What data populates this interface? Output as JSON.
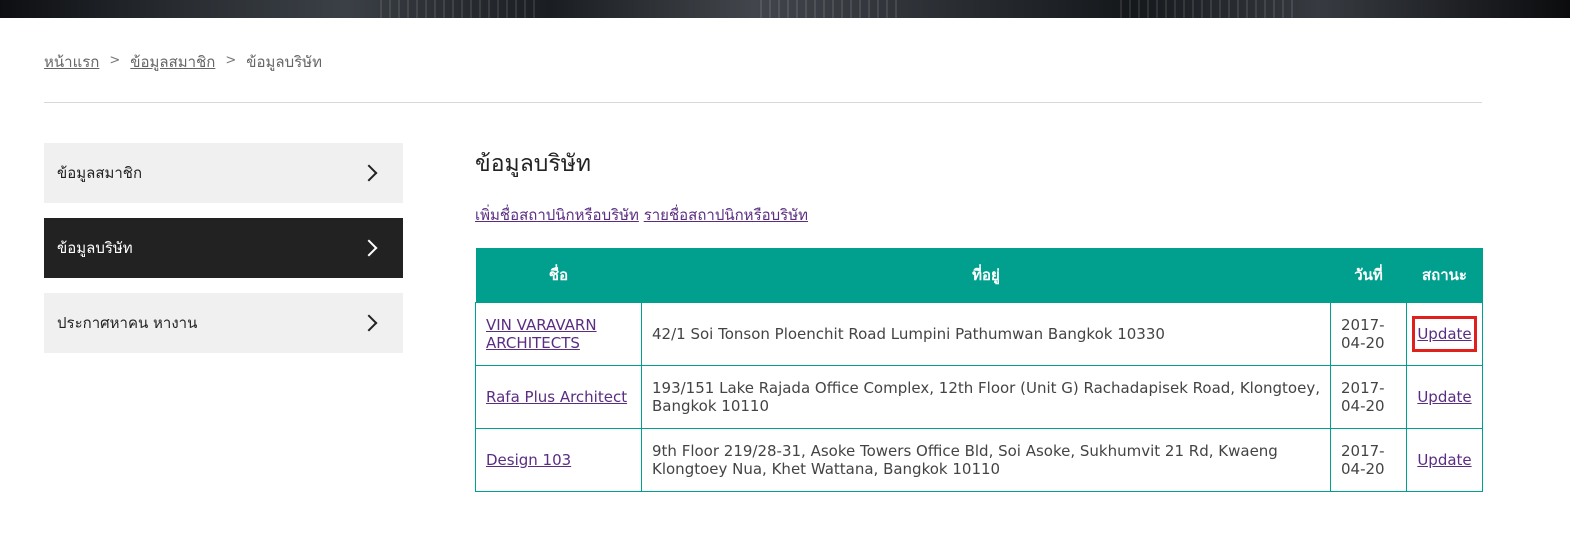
{
  "breadcrumb": {
    "home": "หน้าแรก",
    "member": "ข้อมูลสมาชิก",
    "current": "ข้อมูลบริษัท",
    "separator": ">"
  },
  "sidebar": {
    "items": [
      {
        "label": "ข้อมูลสมาชิก",
        "active": false
      },
      {
        "label": "ข้อมูลบริษัท",
        "active": true
      },
      {
        "label": "ประกาศหาคน หางาน",
        "active": false
      }
    ]
  },
  "main": {
    "title": "ข้อมูลบริษัท",
    "link_add": "เพิ่มชื่อสถาปนิกหรือบริษัท",
    "link_list": "รายชื่อสถาปนิกหรือบริษัท"
  },
  "table": {
    "headers": {
      "name": "ชื่อ",
      "address": "ที่อยู่",
      "date": "วันที่",
      "status": "สถานะ"
    },
    "rows": [
      {
        "name": "VIN VARAVARN ARCHITECTS",
        "address": "42/1 Soi Tonson Ploenchit Road Lumpini Pathumwan Bangkok 10330",
        "date": "2017-04-20",
        "action": "Update",
        "highlighted": true
      },
      {
        "name": "Rafa Plus Architect",
        "address": "193/151 Lake Rajada Office Complex, 12th Floor (Unit G) Rachadapisek Road, Klongtoey, Bangkok 10110",
        "date": "2017-04-20",
        "action": "Update",
        "highlighted": false
      },
      {
        "name": "Design 103",
        "address": "9th Floor 219/28-31, Asoke Towers Office Bld, Soi Asoke, Sukhumvit 21 Rd, Kwaeng Klongtoey Nua, Khet Wattana, Bangkok 10110",
        "date": "2017-04-20",
        "action": "Update",
        "highlighted": false
      }
    ]
  },
  "colors": {
    "accent": "#009f8e",
    "link": "#5a2d82",
    "active_sidebar": "#222222",
    "highlight": "#e0201c"
  },
  "icons": {
    "sidebar_arrow": "chevron-right-icon"
  }
}
